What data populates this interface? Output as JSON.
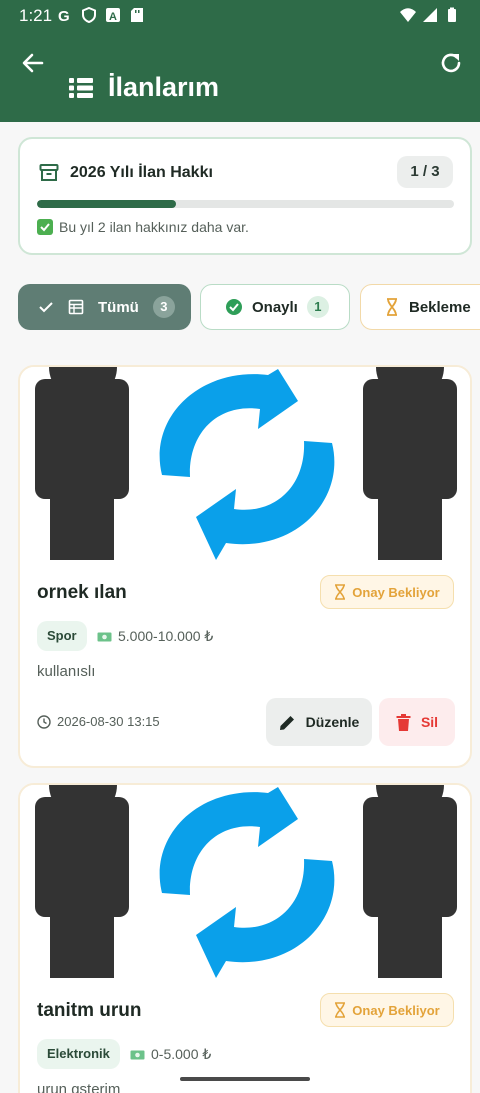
{
  "status_bar": {
    "time": "1:21",
    "left_icons": [
      "google-icon",
      "shield-icon",
      "font-icon",
      "sd-card-icon"
    ],
    "right_icons": [
      "wifi-icon",
      "signal-icon",
      "battery-icon"
    ]
  },
  "header": {
    "title": "İlanlarım",
    "back_icon": "arrow-left-icon",
    "refresh_icon": "refresh-icon",
    "title_icon": "list-icon",
    "color": "#2e6b48"
  },
  "quota": {
    "title": "2026 Yılı İlan Hakkı",
    "badge": "1 / 3",
    "progress": 0.333,
    "note": "Bu yıl 2 ilan hakkınız daha var."
  },
  "filters": [
    {
      "label": "Tümü",
      "count": "3",
      "selected": true
    },
    {
      "label": "Onaylı",
      "count": "1",
      "selected": false
    },
    {
      "label": "Bekleme",
      "selected": false
    }
  ],
  "listings": [
    {
      "title": "ornek ılan",
      "status": "Onay Bekliyor",
      "category": "Spor",
      "price": "5.000-10.000 ₺",
      "description": "kullanıslı",
      "date": "2026-08-30 13:15",
      "edit_label": "Düzenle",
      "delete_label": "Sil"
    },
    {
      "title": "tanitm urun",
      "status": "Onay Bekliyor",
      "category": "Elektronik",
      "price": "0-5.000 ₺",
      "description": "urun gsterim"
    }
  ],
  "colors": {
    "primary": "#2e6b48",
    "pending": "#e3a33a",
    "delete": "#e53935",
    "image_arrows": "#0aa0ea"
  }
}
